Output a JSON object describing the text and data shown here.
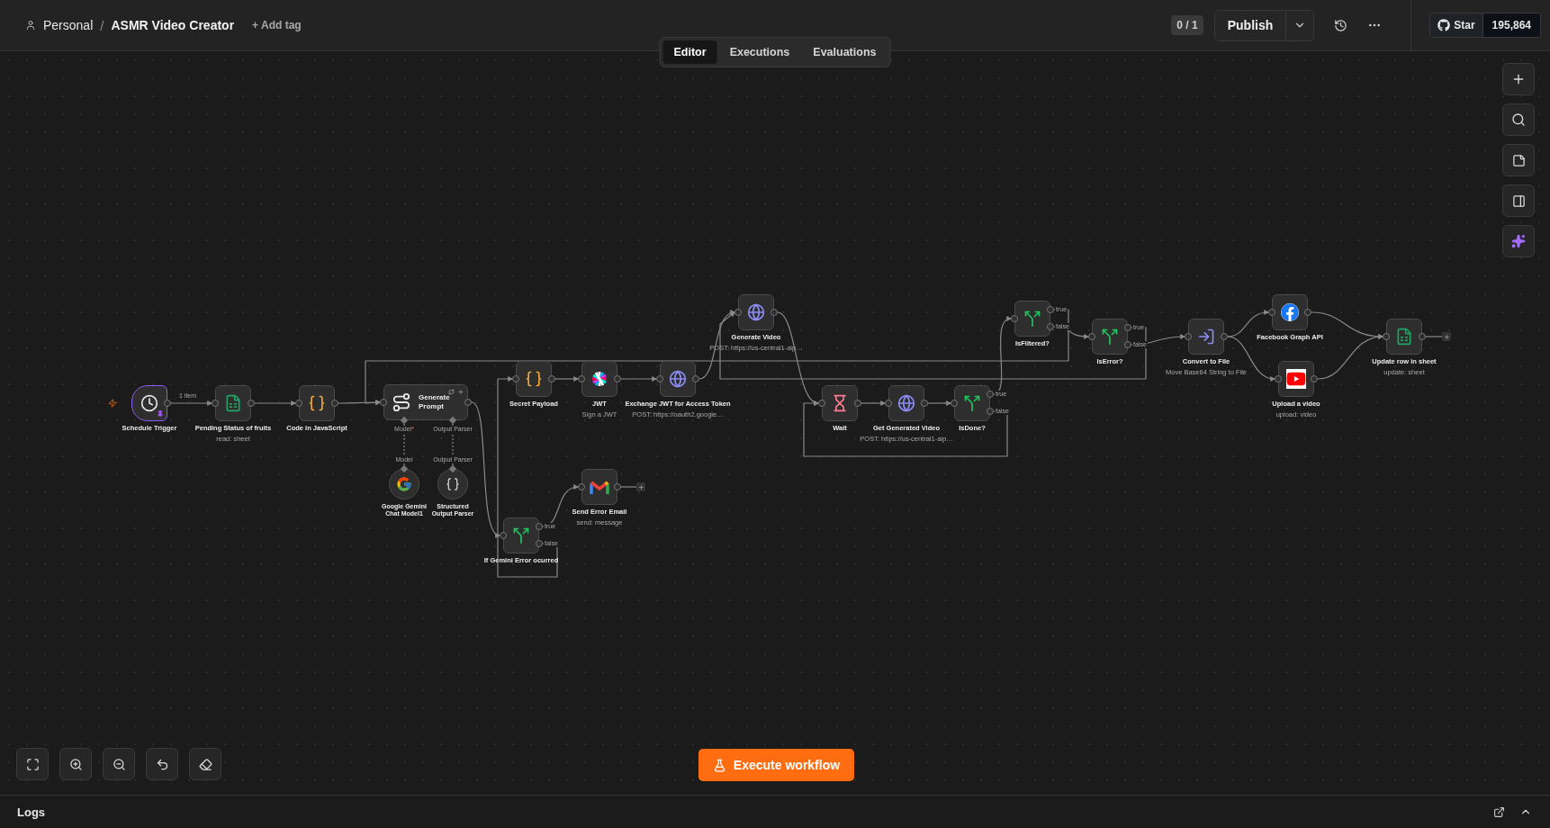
{
  "topbar": {
    "owner": "Personal",
    "separator": "/",
    "title": "ASMR Video Creator",
    "add_tag": "+ Add tag",
    "version_count": "0 / 1",
    "publish": "Publish",
    "github": {
      "star": "Star",
      "count": "195,864"
    }
  },
  "tabs": [
    {
      "label": "Editor",
      "selected": true
    },
    {
      "label": "Executions",
      "selected": false
    },
    {
      "label": "Evaluations",
      "selected": false
    }
  ],
  "nodes": [
    {
      "kind": "trigger",
      "label": "Schedule Trigger",
      "pinned": true,
      "output_label": "1 item"
    },
    {
      "kind": "sheets",
      "label": "Pending Status of fruits",
      "subtitle": "read: sheet"
    },
    {
      "kind": "code",
      "label": "Code in JavaScript"
    },
    {
      "kind": "chain",
      "label": "Generate Prompt",
      "inputs": [
        {
          "label": "Model",
          "mark": "*"
        },
        {
          "label": "Output Parser"
        }
      ]
    },
    {
      "kind": "model",
      "label": "Google Gemini Chat Model1",
      "port_label": "Model"
    },
    {
      "kind": "parser",
      "label": "Structured Output Parser",
      "port_label": "Output Parser"
    },
    {
      "kind": "code",
      "label": "Secret Payload"
    },
    {
      "kind": "if",
      "label": "If Gemini Error ocurred",
      "outputs": [
        "true",
        "false"
      ]
    },
    {
      "kind": "jwt",
      "label": "JWT",
      "subtitle": "Sign a JWT"
    },
    {
      "kind": "http",
      "label": "Exchange JWT for Access Token",
      "subtitle": "POST: https://oauth2.google…"
    },
    {
      "kind": "gmail",
      "label": "Send Error Email",
      "subtitle": "send: message"
    },
    {
      "kind": "http",
      "label": "Generate Video",
      "subtitle": "POST: https://us-central1-aip…"
    },
    {
      "kind": "wait",
      "label": "Wait"
    },
    {
      "kind": "http",
      "label": "Get Generated Video",
      "subtitle": "POST: https://us-central1-aip…"
    },
    {
      "kind": "if",
      "label": "IsDone?",
      "outputs": [
        "true",
        "false"
      ]
    },
    {
      "kind": "if",
      "label": "IsFiltered?",
      "outputs": [
        "true",
        "false"
      ]
    },
    {
      "kind": "if",
      "label": "IsError?",
      "outputs": [
        "true",
        "false"
      ]
    },
    {
      "kind": "convert",
      "label": "Convert to File",
      "subtitle": "Move Base64 String to File"
    },
    {
      "kind": "facebook",
      "label": "Facebook Graph API"
    },
    {
      "kind": "youtube",
      "label": "Upload a video",
      "subtitle": "upload: video"
    },
    {
      "kind": "sheets",
      "label": "Update row in sheet",
      "subtitle": "update: sheet"
    }
  ],
  "execute_button": "Execute workflow",
  "logs": {
    "title": "Logs"
  }
}
